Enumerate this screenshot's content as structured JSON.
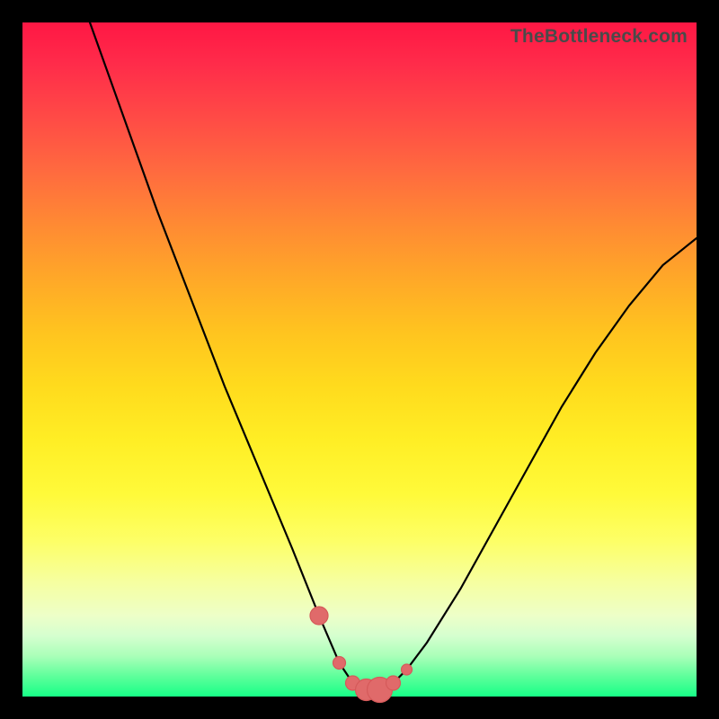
{
  "watermark": "TheBottleneck.com",
  "colors": {
    "frame": "#000000",
    "curve": "#000000",
    "marker_fill": "#e06a6a",
    "marker_stroke": "#d55a5a"
  },
  "chart_data": {
    "type": "line",
    "title": "",
    "xlabel": "",
    "ylabel": "",
    "xlim": [
      0,
      100
    ],
    "ylim": [
      0,
      100
    ],
    "grid": false,
    "legend": false,
    "annotations": [
      "TheBottleneck.com"
    ],
    "series": [
      {
        "name": "bottleneck-curve",
        "x": [
          10,
          15,
          20,
          25,
          30,
          35,
          40,
          44,
          47,
          49,
          51,
          53,
          55,
          57,
          60,
          65,
          70,
          75,
          80,
          85,
          90,
          95,
          100
        ],
        "values": [
          100,
          86,
          72,
          59,
          46,
          34,
          22,
          12,
          5,
          2,
          1,
          1,
          2,
          4,
          8,
          16,
          25,
          34,
          43,
          51,
          58,
          64,
          68
        ]
      }
    ],
    "markers": {
      "name": "highlight-points",
      "x": [
        44,
        47,
        49,
        51,
        53,
        55,
        57
      ],
      "values": [
        12,
        5,
        2,
        1,
        1,
        2,
        4
      ],
      "radius_px": [
        10,
        7,
        8,
        12,
        14,
        8,
        6
      ]
    }
  }
}
